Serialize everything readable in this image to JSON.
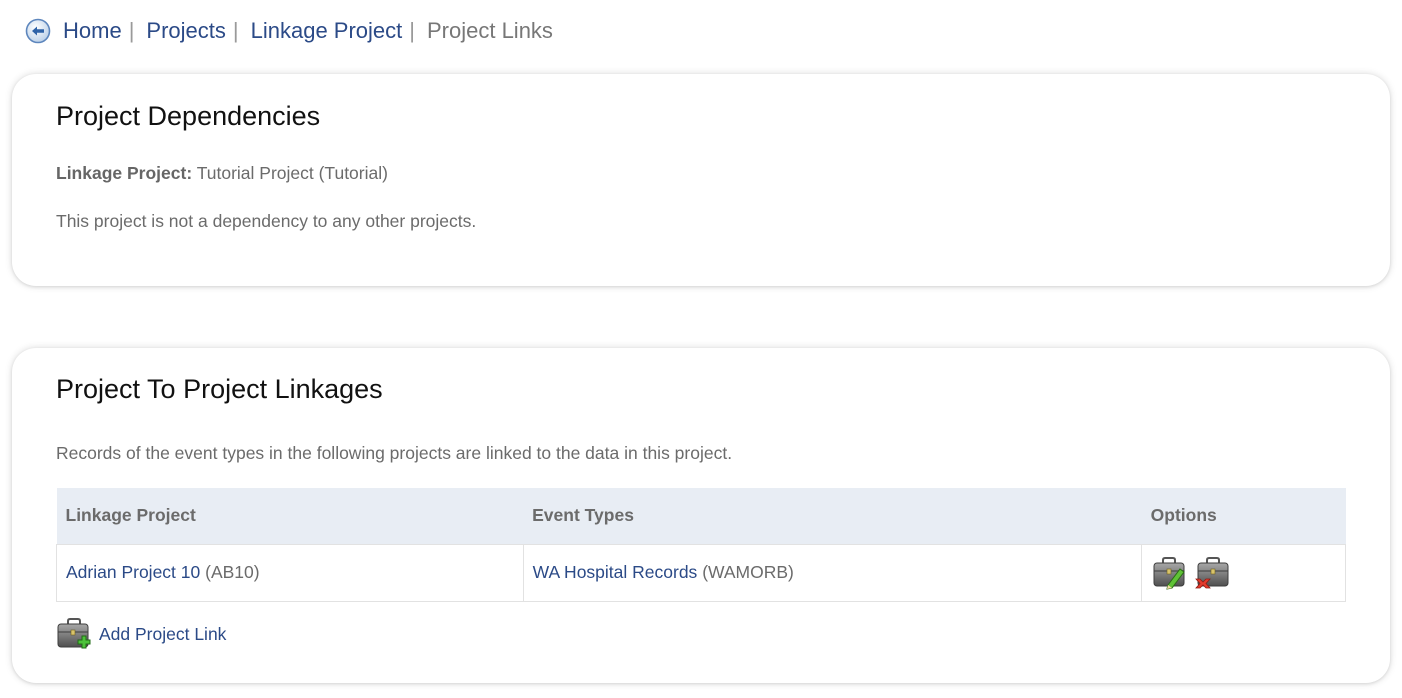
{
  "breadcrumb": {
    "items": [
      {
        "label": "Home"
      },
      {
        "label": "Projects"
      },
      {
        "label": "Linkage Project"
      }
    ],
    "separator": "|",
    "current": "Project Links"
  },
  "dependencies": {
    "title": "Project Dependencies",
    "linkage_label": "Linkage Project:",
    "linkage_value": "Tutorial Project (Tutorial)",
    "message": "This project is not a dependency to any other projects."
  },
  "linkages": {
    "title": "Project To Project Linkages",
    "description": "Records of the event types in the following projects are linked to the data in this project.",
    "columns": [
      "Linkage Project",
      "Event Types",
      "Options"
    ],
    "rows": [
      {
        "project_name": "Adrian Project 10",
        "project_code": "(AB10)",
        "event_name": "WA Hospital Records",
        "event_code": "(WAMORB)"
      }
    ],
    "add_label": "Add Project Link"
  },
  "icons": {
    "back": "back-arrow-icon",
    "edit": "briefcase-edit-icon",
    "delete": "briefcase-delete-icon",
    "add": "briefcase-add-icon"
  },
  "colors": {
    "link": "#2b4a87",
    "header_bg": "#e8edf4",
    "text": "#6b6b6b",
    "title": "#111111"
  }
}
